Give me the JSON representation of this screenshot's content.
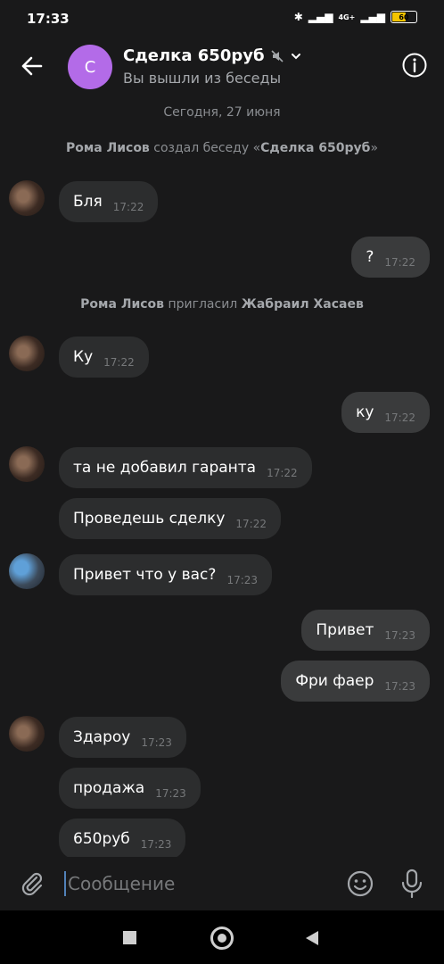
{
  "status": {
    "time": "17:33",
    "network": "4G+",
    "battery": "60",
    "battery_level": 0.6
  },
  "header": {
    "avatar_letter": "С",
    "title": "Сделка 650руб",
    "subtitle": "Вы вышли из беседы"
  },
  "date_separator": "Сегодня, 27 июня",
  "system": [
    {
      "actor": "Рома Лисов",
      "text": " создал беседу «",
      "target": "Сделка 650руб",
      "suffix": "»"
    },
    {
      "actor": "Рома Лисов",
      "text": " пригласил ",
      "target": "Жабраил Хасаев",
      "suffix": ""
    }
  ],
  "messages": [
    {
      "text": "Бля",
      "time": "17:22"
    },
    {
      "text": "?",
      "time": "17:22"
    },
    {
      "text": "Ку",
      "time": "17:22"
    },
    {
      "text": "ку",
      "time": "17:22"
    },
    {
      "text": "та не добавил гаранта",
      "time": "17:22"
    },
    {
      "text": "Проведешь сделку",
      "time": "17:22"
    },
    {
      "text": "Привет  что у вас?",
      "time": "17:23"
    },
    {
      "text": "Привет",
      "time": "17:23"
    },
    {
      "text": "Фри фаер",
      "time": "17:23"
    },
    {
      "text": "Здароу",
      "time": "17:23"
    },
    {
      "text": "продажа",
      "time": "17:23"
    },
    {
      "text": "650руб",
      "time": "17:23"
    }
  ],
  "input": {
    "placeholder": "Сообщение"
  },
  "icons": [
    "back-arrow-icon",
    "mute-icon",
    "chevron-down-icon",
    "info-icon",
    "attach-icon",
    "emoji-icon",
    "microphone-icon"
  ]
}
